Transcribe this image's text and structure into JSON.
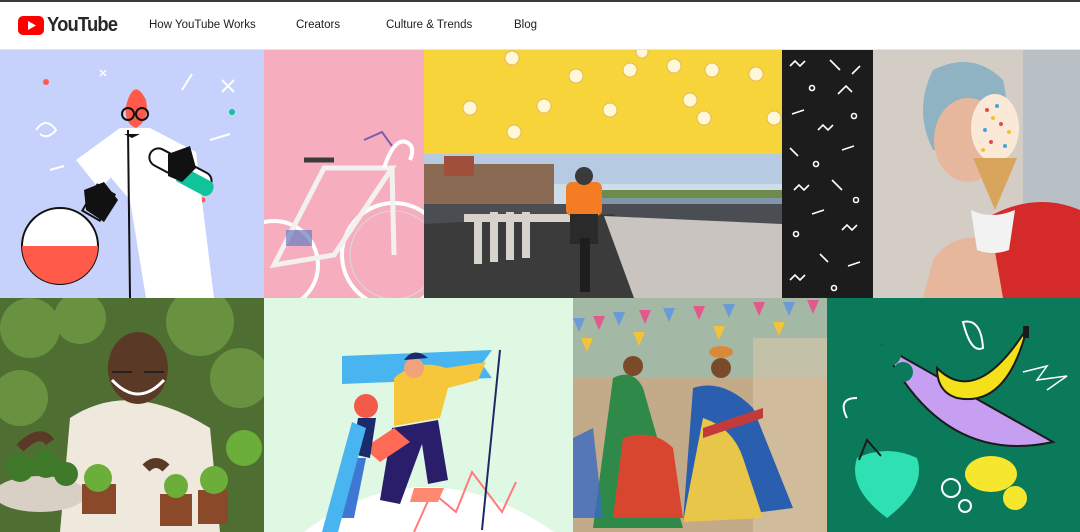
{
  "brand": {
    "name": "YouTube",
    "colors": {
      "logo_red": "#ff0000",
      "text": "#282828"
    }
  },
  "nav": {
    "items": [
      {
        "label": "How YouTube Works"
      },
      {
        "label": "Creators"
      },
      {
        "label": "Culture & Trends"
      },
      {
        "label": "Blog"
      }
    ]
  },
  "mosaic": {
    "tiles": [
      {
        "name": "scientist-illustration",
        "kind": "illustration",
        "bg": "#c6d2fb"
      },
      {
        "name": "bicycle-photo",
        "kind": "photo",
        "bg": "#f4a8bb"
      },
      {
        "name": "popcorn-photo",
        "kind": "photo",
        "bg": "#f7d43a"
      },
      {
        "name": "motorbike-riverside-photo",
        "kind": "photo",
        "bg": "#9fb3cc"
      },
      {
        "name": "squiggle-pattern",
        "kind": "pattern",
        "bg": "#1c1c1c"
      },
      {
        "name": "ice-cream-photo",
        "kind": "photo",
        "bg": "#cfc9c2"
      },
      {
        "name": "gardener-photo",
        "kind": "photo",
        "bg": "#5b7a3a"
      },
      {
        "name": "climbers-illustration",
        "kind": "illustration",
        "bg": "#dff8e4"
      },
      {
        "name": "dancers-photo",
        "kind": "photo",
        "bg": "#b49a7a"
      },
      {
        "name": "fruit-illustration",
        "kind": "illustration",
        "bg": "#0a7a5b"
      }
    ]
  }
}
